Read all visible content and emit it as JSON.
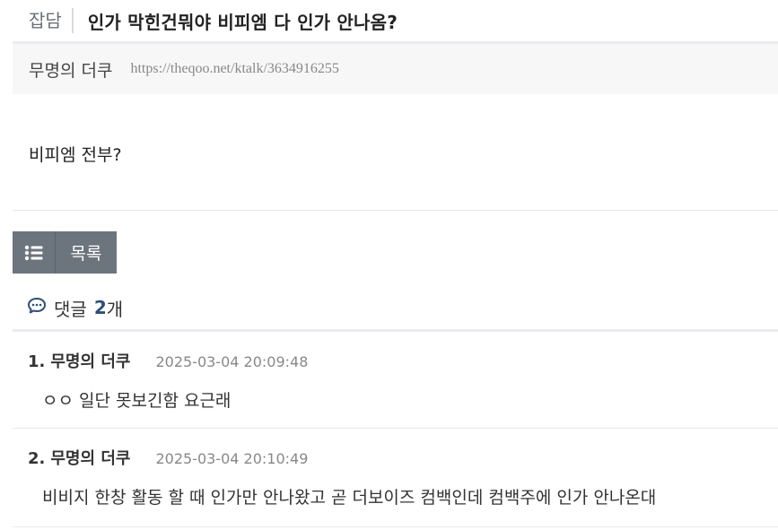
{
  "post": {
    "category": "잡담",
    "title": "인가 막힌건뭐야 비피엠 다 인가 안나옴?",
    "author": "무명의 더쿠",
    "url": "https://theqoo.net/ktalk/3634916255",
    "body": "비피엠 전부?"
  },
  "actions": {
    "list_label": "목록",
    "list_icon": "list-icon"
  },
  "comments": {
    "icon": "comment-bubble-icon",
    "label": "댓글",
    "count": "2",
    "unit": "개",
    "items": [
      {
        "num": "1.",
        "author": "무명의 더쿠",
        "time": "2025-03-04 20:09:48",
        "text": "ㅇㅇ 일단 못보긴함 요근래"
      },
      {
        "num": "2.",
        "author": "무명의 더쿠",
        "time": "2025-03-04 20:10:49",
        "text": "비비지 한창 활동 할 때 인가만 안나왔고 곧 더보이즈 컴백인데 컴백주에 인가 안나온대"
      }
    ]
  },
  "colors": {
    "button_bg": "#6c757d",
    "count_accent": "#2d4f77",
    "meta_bg": "#f7f7f8"
  }
}
